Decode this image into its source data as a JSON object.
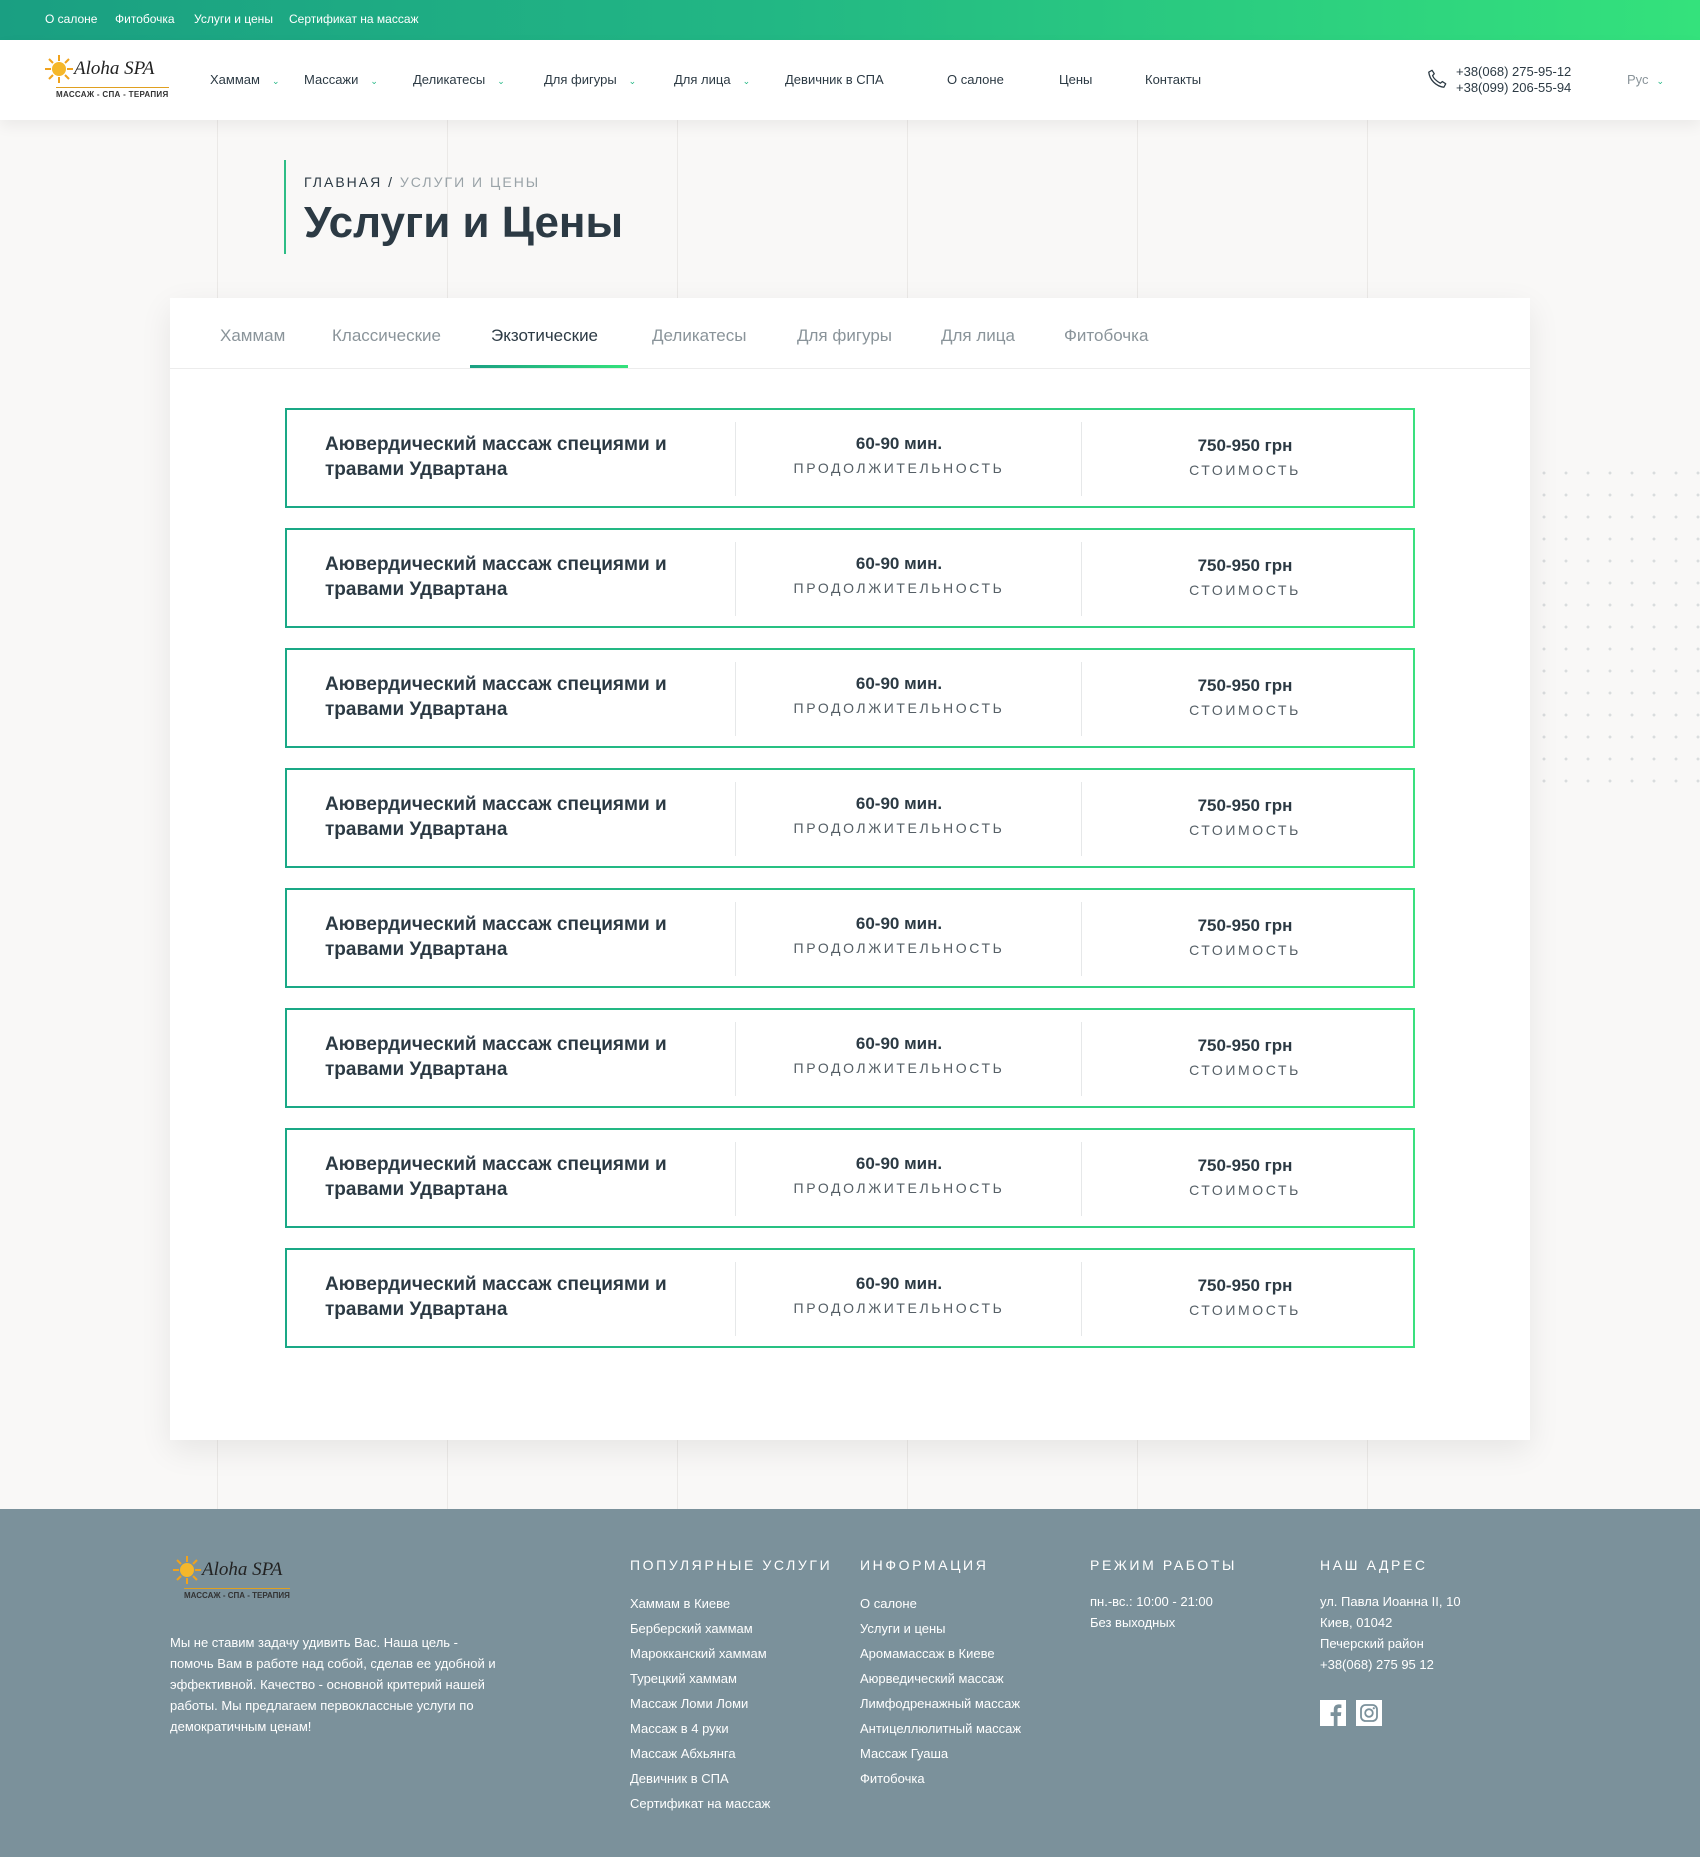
{
  "topbar": {
    "links": [
      "О салоне",
      "Фитобочка",
      "Услуги и цены",
      "Сертификат на массаж"
    ]
  },
  "header": {
    "logo": {
      "name": "Aloha SPA",
      "tagline": "МАССАЖ - СПА - ТЕРАПИЯ"
    },
    "nav": [
      {
        "label": "Хаммам",
        "has_dropdown": true
      },
      {
        "label": "Массажи",
        "has_dropdown": true
      },
      {
        "label": "Деликатесы",
        "has_dropdown": true
      },
      {
        "label": "Для фигуры",
        "has_dropdown": true
      },
      {
        "label": "Для лица",
        "has_dropdown": true
      },
      {
        "label": "Девичник в СПА",
        "has_dropdown": false
      },
      {
        "label": "О салоне",
        "has_dropdown": false
      },
      {
        "label": "Цены",
        "has_dropdown": false
      },
      {
        "label": "Контакты",
        "has_dropdown": false
      }
    ],
    "phones": [
      "+38(068) 275-95-12",
      "+38(099) 206-55-94"
    ],
    "language": "Рус"
  },
  "page": {
    "breadcrumb": {
      "home": "ГЛАВНАЯ",
      "separator": "/",
      "current": "УСЛУГИ И ЦЕНЫ"
    },
    "title": "Услуги и Цены"
  },
  "tabs": {
    "items": [
      "Хаммам",
      "Классические",
      "Экзотические",
      "Деликатесы",
      "Для фигуры",
      "Для лица",
      "Фитобочка"
    ],
    "active": "Экзотические"
  },
  "services": [
    {
      "name": "Аювердический массаж специями и травами Удвартана",
      "duration": "60-90 мин.",
      "duration_label": "ПРОДОЛЖИТЕЛЬНОСТЬ",
      "price": "750-950 грн",
      "price_label": "СТОИМОСТЬ"
    },
    {
      "name": "Аювердический массаж специями и травами Удвартана",
      "duration": "60-90 мин.",
      "duration_label": "ПРОДОЛЖИТЕЛЬНОСТЬ",
      "price": "750-950 грн",
      "price_label": "СТОИМОСТЬ"
    },
    {
      "name": "Аювердический массаж специями и травами Удвартана",
      "duration": "60-90 мин.",
      "duration_label": "ПРОДОЛЖИТЕЛЬНОСТЬ",
      "price": "750-950 грн",
      "price_label": "СТОИМОСТЬ"
    },
    {
      "name": "Аювердический массаж специями и травами Удвартана",
      "duration": "60-90 мин.",
      "duration_label": "ПРОДОЛЖИТЕЛЬНОСТЬ",
      "price": "750-950 грн",
      "price_label": "СТОИМОСТЬ"
    },
    {
      "name": "Аювердический массаж специями и травами Удвартана",
      "duration": "60-90 мин.",
      "duration_label": "ПРОДОЛЖИТЕЛЬНОСТЬ",
      "price": "750-950 грн",
      "price_label": "СТОИМОСТЬ"
    },
    {
      "name": "Аювердический массаж специями и травами Удвартана",
      "duration": "60-90 мин.",
      "duration_label": "ПРОДОЛЖИТЕЛЬНОСТЬ",
      "price": "750-950 грн",
      "price_label": "СТОИМОСТЬ"
    },
    {
      "name": "Аювердический массаж специями и травами Удвартана",
      "duration": "60-90 мин.",
      "duration_label": "ПРОДОЛЖИТЕЛЬНОСТЬ",
      "price": "750-950 грн",
      "price_label": "СТОИМОСТЬ"
    },
    {
      "name": "Аювердический массаж специями и травами Удвартана",
      "duration": "60-90 мин.",
      "duration_label": "ПРОДОЛЖИТЕЛЬНОСТЬ",
      "price": "750-950 грн",
      "price_label": "СТОИМОСТЬ"
    }
  ],
  "footer": {
    "about": "Мы не ставим задачу удивить Вас. Наша цель - помочь Вам в работе над собой, сделав ее удобной и эффективной. Качество - основной критерий нашей работы. Мы предлагаем первоклассные услуги по демократичным ценам!",
    "popular": {
      "heading": "ПОПУЛЯРНЫЕ УСЛУГИ",
      "links": [
        "Хаммам в Киеве",
        "Берберский хаммам",
        "Марокканский хаммам",
        "Турецкий хаммам",
        "Массаж Ломи Ломи",
        "Массаж в 4 руки",
        "Массаж Абхьянга",
        "Девичник в СПА",
        "Сертификат на массаж"
      ]
    },
    "info": {
      "heading": "ИНФОРМАЦИЯ",
      "links": [
        "О салоне",
        "Услуги и цены",
        "Аромамассаж в Киеве",
        "Аюрведический массаж",
        "Лимфодренажный массаж",
        "Антицеллюлитный массаж",
        "Массаж Гуаша",
        "Фитобочка"
      ]
    },
    "hours": {
      "heading": "РЕЖИМ РАБОТЫ",
      "lines": [
        "пн.-вс.: 10:00 - 21:00",
        "Без выходных"
      ]
    },
    "address": {
      "heading": "НАШ АДРЕС",
      "lines": [
        "ул. Павла Иоанна II, 10",
        "Киев, 01042",
        "Печерский район",
        "+38(068) 275 95 12"
      ]
    },
    "social": [
      "facebook-icon",
      "instagram-icon"
    ]
  },
  "colors": {
    "accent_start": "#1a9f82",
    "accent_end": "#34e27c",
    "text": "#2c3a44",
    "muted": "#8a949a",
    "footer_bg": "#7b919b"
  }
}
